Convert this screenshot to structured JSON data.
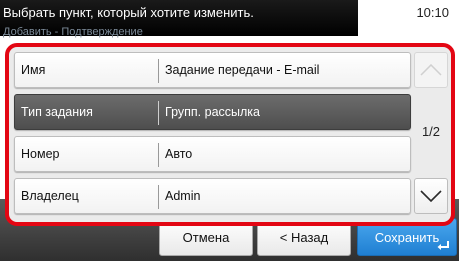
{
  "header": {
    "prompt": "Выбрать пункт, который хотите изменить.",
    "subtitle": "Добавить - Подтверждение",
    "time": "10:10"
  },
  "rows": [
    {
      "label": "Имя",
      "value": "Задание передачи - E-mail",
      "selected": false
    },
    {
      "label": "Тип задания",
      "value": "Групп. рассылка",
      "selected": true
    },
    {
      "label": "Номер",
      "value": "Авто",
      "selected": false
    },
    {
      "label": "Владелец",
      "value": "Admin",
      "selected": false
    }
  ],
  "pager": {
    "page": "1/2",
    "up_icon": "chevron-up-icon",
    "down_icon": "chevron-down-icon"
  },
  "footer": {
    "cancel_label": "Отмена",
    "back_label": "< Назад",
    "save_label": "Сохранить"
  },
  "colors": {
    "highlight": "#e30613",
    "primary": "#2a8ee0",
    "selected_row": "#5c5c5c"
  }
}
